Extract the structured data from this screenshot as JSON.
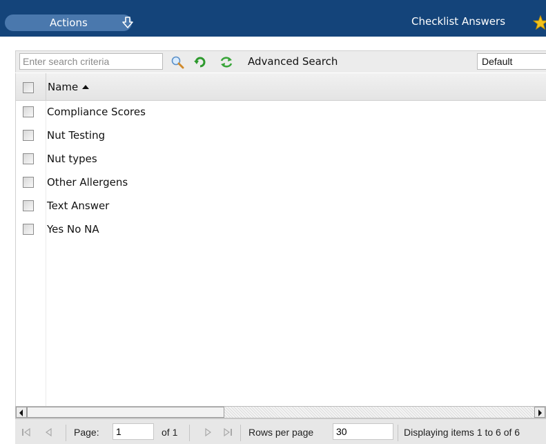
{
  "header": {
    "actions_label": "Actions",
    "title": "Checklist Answers",
    "actions_icon": "arrow-down-icon",
    "favorite_icon": "star-icon",
    "bar_color": "#14447a",
    "button_color": "#4a78ad"
  },
  "search": {
    "placeholder": "Enter search criteria",
    "advanced_label": "Advanced Search",
    "view_selected": "Default",
    "icons": [
      "search-icon",
      "reset-icon",
      "refresh-icon"
    ]
  },
  "grid": {
    "column_name": "Name",
    "sort": "ascending",
    "rows": [
      {
        "name": "Compliance Scores"
      },
      {
        "name": "Nut Testing"
      },
      {
        "name": "Nut types"
      },
      {
        "name": "Other Allergens"
      },
      {
        "name": "Text Answer"
      },
      {
        "name": "Yes No NA"
      }
    ]
  },
  "pager": {
    "page_label": "Page:",
    "page_value": "1",
    "of_label": "of 1",
    "rows_label": "Rows per page",
    "rows_value": "30",
    "display_text": "Displaying items 1 to 6 of 6"
  }
}
